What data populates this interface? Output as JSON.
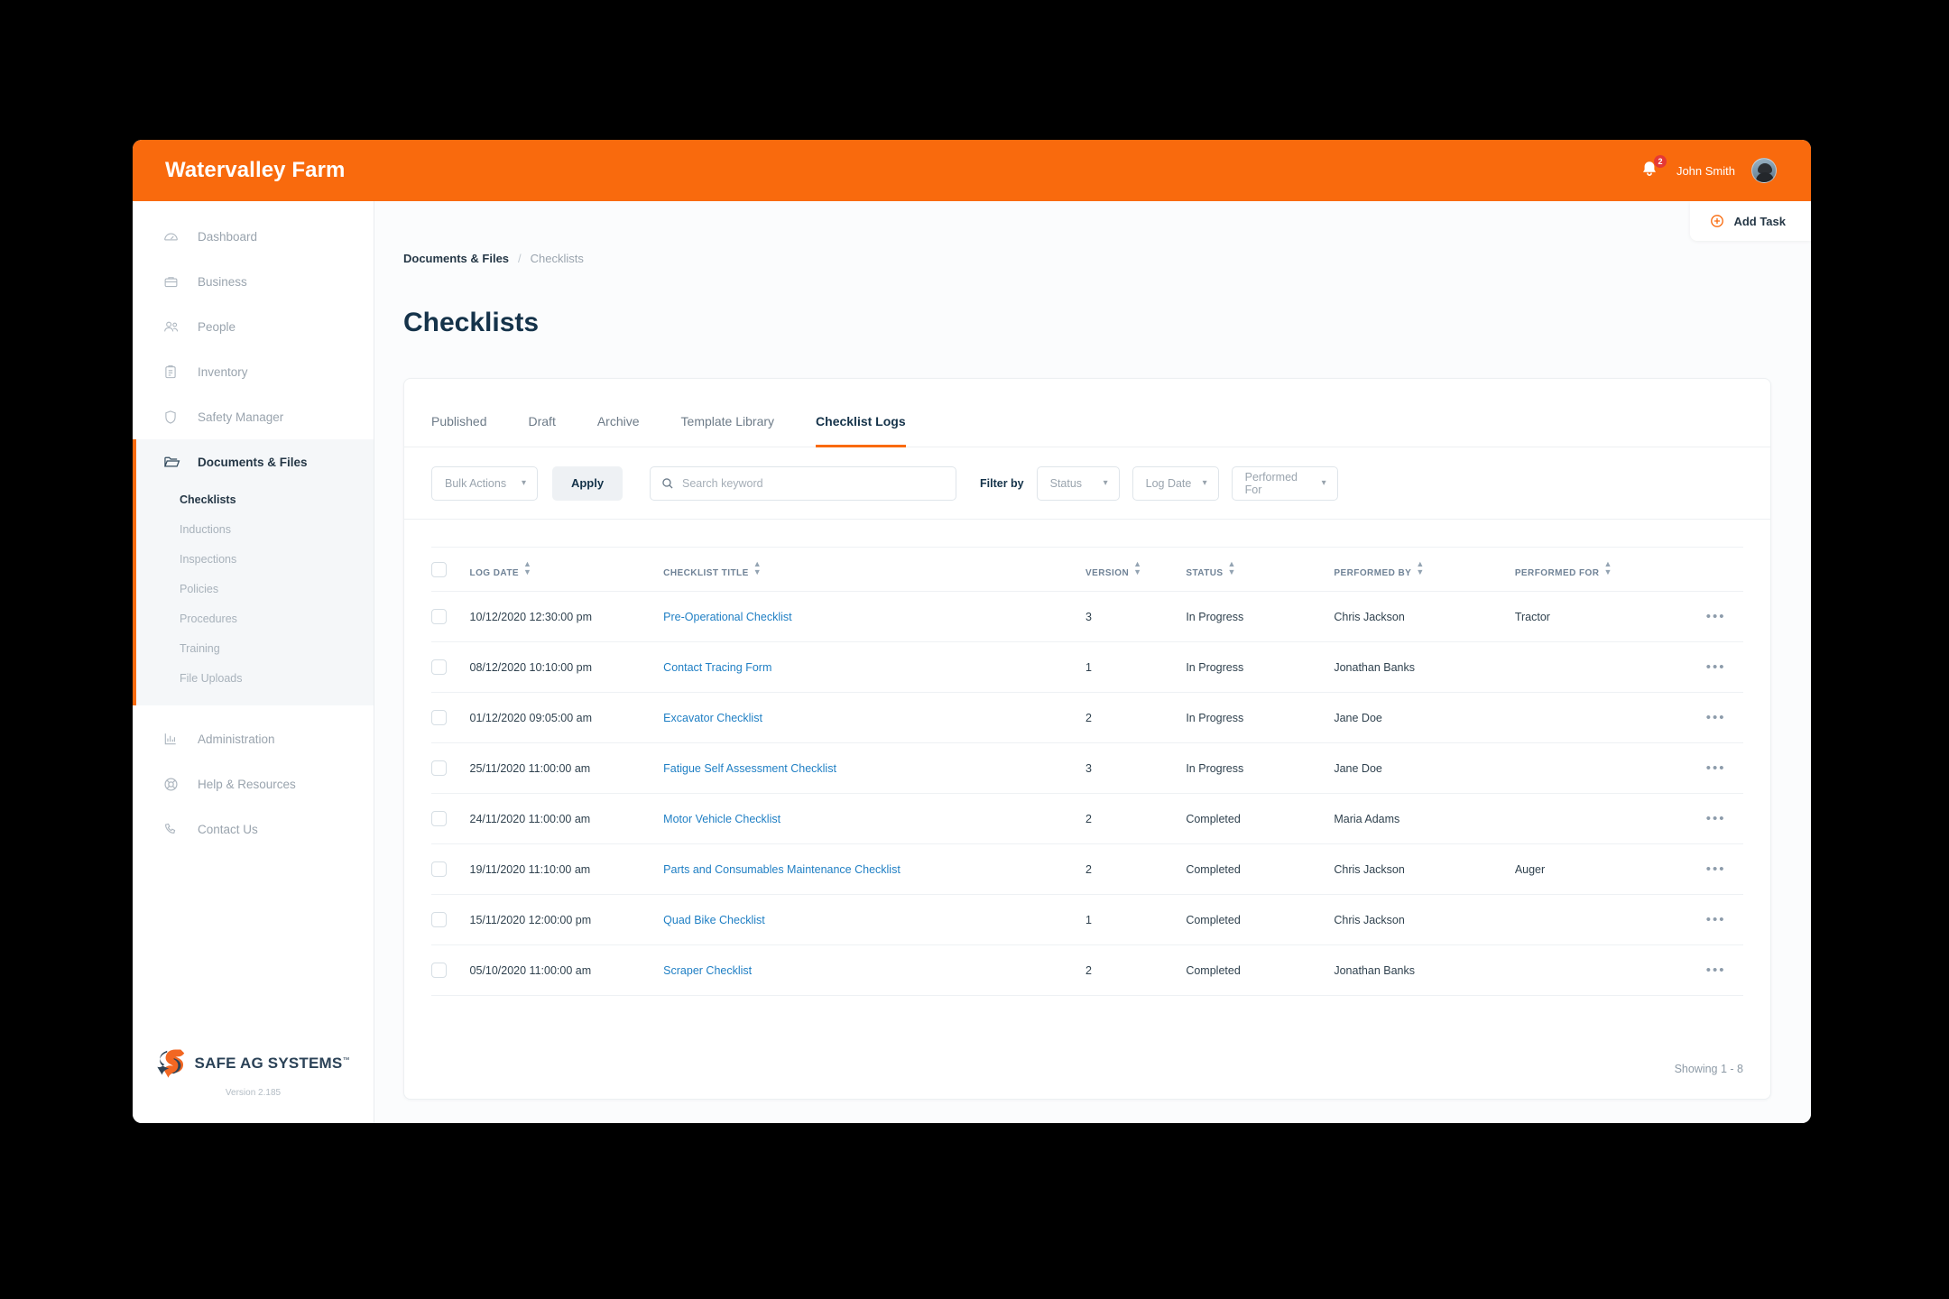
{
  "topbar": {
    "brand": "Watervalley Farm",
    "notification_count": "2",
    "user_name": "John Smith",
    "bell_icon": "bell-icon",
    "avatar_icon": "avatar"
  },
  "add_task": {
    "label": "Add Task",
    "icon": "plus-circle-icon"
  },
  "sidebar": {
    "items": [
      {
        "label": "Dashboard",
        "icon": "gauge-icon",
        "active": false
      },
      {
        "label": "Business",
        "icon": "briefcase-icon",
        "active": false
      },
      {
        "label": "People",
        "icon": "people-icon",
        "active": false
      },
      {
        "label": "Inventory",
        "icon": "clipboard-icon",
        "active": false
      },
      {
        "label": "Safety Manager",
        "icon": "shield-icon",
        "active": false
      },
      {
        "label": "Documents & Files",
        "icon": "folder-icon",
        "active": true
      }
    ],
    "sub_items": [
      {
        "label": "Checklists",
        "current": true
      },
      {
        "label": "Inductions",
        "current": false
      },
      {
        "label": "Inspections",
        "current": false
      },
      {
        "label": "Policies",
        "current": false
      },
      {
        "label": "Procedures",
        "current": false
      },
      {
        "label": "Training",
        "current": false
      },
      {
        "label": "File Uploads",
        "current": false
      }
    ],
    "bottom_items": [
      {
        "label": "Administration",
        "icon": "bar-chart-icon"
      },
      {
        "label": "Help & Resources",
        "icon": "lifebuoy-icon"
      },
      {
        "label": "Contact Us",
        "icon": "phone-icon"
      }
    ],
    "footer": {
      "logo_text": "SAFE AG SYSTEMS",
      "logo_tm": "™",
      "version": "Version 2.185"
    }
  },
  "breadcrumb": {
    "parent": "Documents & Files",
    "separator": "/",
    "current": "Checklists"
  },
  "page_title": "Checklists",
  "tabs": [
    {
      "label": "Published",
      "active": false
    },
    {
      "label": "Draft",
      "active": false
    },
    {
      "label": "Archive",
      "active": false
    },
    {
      "label": "Template Library",
      "active": false
    },
    {
      "label": "Checklist Logs",
      "active": true
    }
  ],
  "toolbar": {
    "bulk_actions_label": "Bulk Actions",
    "apply_label": "Apply",
    "search_placeholder": "Search keyword",
    "search_value": "",
    "search_icon": "search-icon",
    "filter_by_label": "Filter by",
    "filters": [
      {
        "label": "Status"
      },
      {
        "label": "Log Date"
      },
      {
        "label": "Performed For"
      }
    ]
  },
  "table": {
    "columns": [
      {
        "key": "log_date",
        "label": "LOG DATE",
        "sortable": true
      },
      {
        "key": "title",
        "label": "CHECKLIST TITLE",
        "sortable": true
      },
      {
        "key": "version",
        "label": "VERSION",
        "sortable": true
      },
      {
        "key": "status",
        "label": "STATUS",
        "sortable": true
      },
      {
        "key": "performed_by",
        "label": "PERFORMED BY",
        "sortable": true
      },
      {
        "key": "performed_for",
        "label": "PERFORMED FOR",
        "sortable": true
      }
    ],
    "rows": [
      {
        "log_date": "10/12/2020 12:30:00 pm",
        "title": "Pre-Operational Checklist",
        "version": "3",
        "status": "In Progress",
        "performed_by": "Chris Jackson",
        "performed_for": "Tractor"
      },
      {
        "log_date": "08/12/2020 10:10:00 pm",
        "title": "Contact Tracing Form",
        "version": "1",
        "status": "In Progress",
        "performed_by": "Jonathan Banks",
        "performed_for": ""
      },
      {
        "log_date": "01/12/2020 09:05:00 am",
        "title": "Excavator Checklist",
        "version": "2",
        "status": "In Progress",
        "performed_by": "Jane Doe",
        "performed_for": ""
      },
      {
        "log_date": "25/11/2020 11:00:00 am",
        "title": "Fatigue Self Assessment Checklist",
        "version": "3",
        "status": "In Progress",
        "performed_by": "Jane Doe",
        "performed_for": ""
      },
      {
        "log_date": "24/11/2020 11:00:00 am",
        "title": "Motor Vehicle Checklist",
        "version": "2",
        "status": "Completed",
        "performed_by": "Maria Adams",
        "performed_for": ""
      },
      {
        "log_date": "19/11/2020 11:10:00 am",
        "title": "Parts and Consumables Maintenance Checklist",
        "version": "2",
        "status": "Completed",
        "performed_by": "Chris Jackson",
        "performed_for": "Auger"
      },
      {
        "log_date": "15/11/2020 12:00:00 pm",
        "title": "Quad Bike Checklist",
        "version": "1",
        "status": "Completed",
        "performed_by": "Chris Jackson",
        "performed_for": ""
      },
      {
        "log_date": "05/10/2020 11:00:00 am",
        "title": "Scraper Checklist",
        "version": "2",
        "status": "Completed",
        "performed_by": "Jonathan Banks",
        "performed_for": ""
      }
    ],
    "row_action_icon": "ellipsis-icon",
    "showing": "Showing 1 - 8"
  },
  "colors": {
    "brand_orange": "#F96A0D",
    "badge_red": "#E53935",
    "link_blue": "#1F7FC4",
    "text_dark": "#15334A"
  }
}
